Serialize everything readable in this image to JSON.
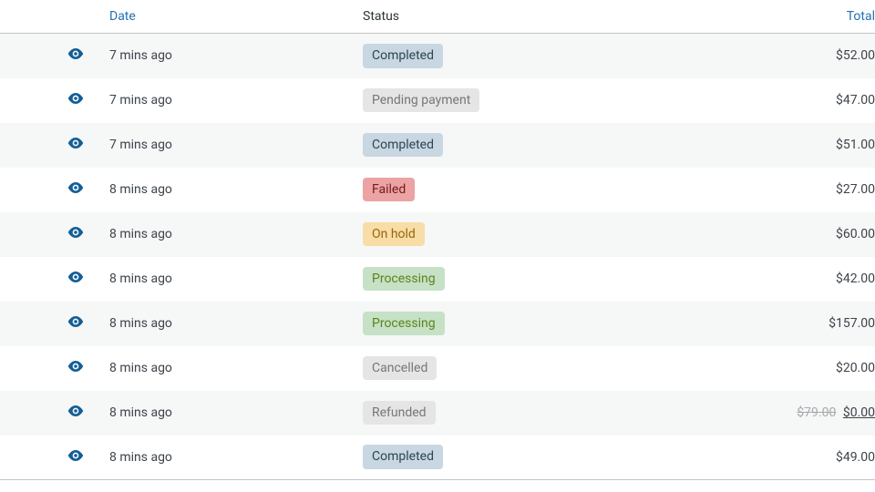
{
  "columns": {
    "date": "Date",
    "status": "Status",
    "total": "Total"
  },
  "status_kind_to_class": {
    "completed": "s-completed",
    "pending": "s-pending",
    "failed": "s-failed",
    "onhold": "s-onhold",
    "processing": "s-processing",
    "cancelled": "s-cancelled",
    "refunded": "s-refunded"
  },
  "rows": [
    {
      "date": "7 mins ago",
      "status_kind": "completed",
      "status_label": "Completed",
      "total": "$52.00"
    },
    {
      "date": "7 mins ago",
      "status_kind": "pending",
      "status_label": "Pending payment",
      "total": "$47.00"
    },
    {
      "date": "7 mins ago",
      "status_kind": "completed",
      "status_label": "Completed",
      "total": "$51.00"
    },
    {
      "date": "8 mins ago",
      "status_kind": "failed",
      "status_label": "Failed",
      "total": "$27.00"
    },
    {
      "date": "8 mins ago",
      "status_kind": "onhold",
      "status_label": "On hold",
      "total": "$60.00"
    },
    {
      "date": "8 mins ago",
      "status_kind": "processing",
      "status_label": "Processing",
      "total": "$42.00"
    },
    {
      "date": "8 mins ago",
      "status_kind": "processing",
      "status_label": "Processing",
      "total": "$157.00"
    },
    {
      "date": "8 mins ago",
      "status_kind": "cancelled",
      "status_label": "Cancelled",
      "total": "$20.00"
    },
    {
      "date": "8 mins ago",
      "status_kind": "refunded",
      "status_label": "Refunded",
      "total": "$0.00",
      "original_total": "$79.00"
    },
    {
      "date": "8 mins ago",
      "status_kind": "completed",
      "status_label": "Completed",
      "total": "$49.00"
    }
  ]
}
